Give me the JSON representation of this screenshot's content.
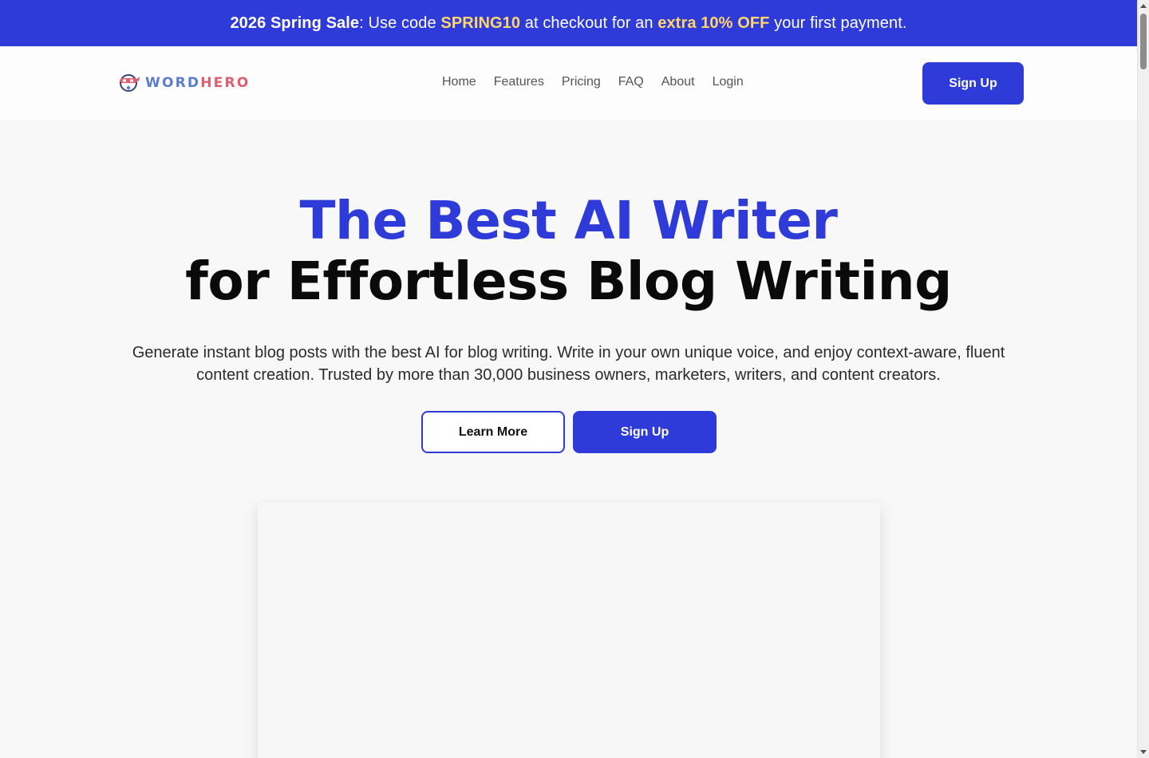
{
  "promo": {
    "part1": "2026 Spring Sale",
    "part2": ": Use code ",
    "code": "SPRING10",
    "part3": " at checkout for an ",
    "discount": "extra 10% OFF",
    "part4": " your first payment."
  },
  "header": {
    "logo_word1": "WORD",
    "logo_word2": "HERO",
    "logo_icon": "ninja-mascot-icon",
    "nav": [
      "Home",
      "Features",
      "Pricing",
      "FAQ",
      "About",
      "Login"
    ],
    "signup_label": "Sign Up"
  },
  "hero": {
    "title_line1": "The Best AI Writer",
    "title_line2": "for Effortless Blog Writing",
    "subtitle": "Generate instant blog posts with the best AI for blog writing. Write in your own unique voice, and enjoy context-aware, fluent content creation. Trusted by more than 30,000 business owners, marketers, writers, and content creators.",
    "learn_more_label": "Learn More",
    "signup_label": "Sign Up"
  },
  "colors": {
    "primary": "#2e3bd8",
    "promo_accent": "#ffd66b",
    "logo_blue": "#5b7bd0",
    "logo_red": "#e05c6f"
  }
}
